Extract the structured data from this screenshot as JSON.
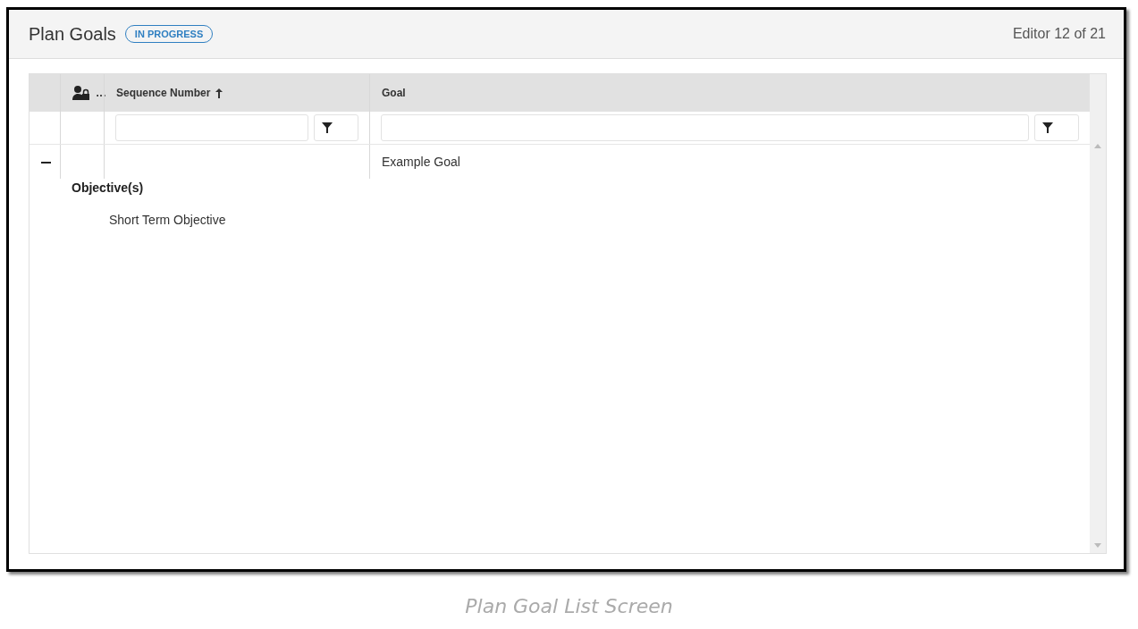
{
  "panel": {
    "title": "Plan Goals",
    "status": "IN PROGRESS",
    "counter": "Editor 12 of 21"
  },
  "table": {
    "columns": [
      {
        "kind": "toggle"
      },
      {
        "kind": "icon",
        "label": "…"
      },
      {
        "kind": "text",
        "label": "Sequence Number",
        "sorted": true,
        "filterable": true
      },
      {
        "kind": "text",
        "label": "Goal",
        "filterable": true
      }
    ],
    "rows": [
      {
        "expanded": true,
        "goal": "Example Goal",
        "detail_heading": "Objective(s)",
        "objectives": [
          "Short Term Objective"
        ]
      }
    ]
  },
  "caption": "Plan Goal List Screen"
}
